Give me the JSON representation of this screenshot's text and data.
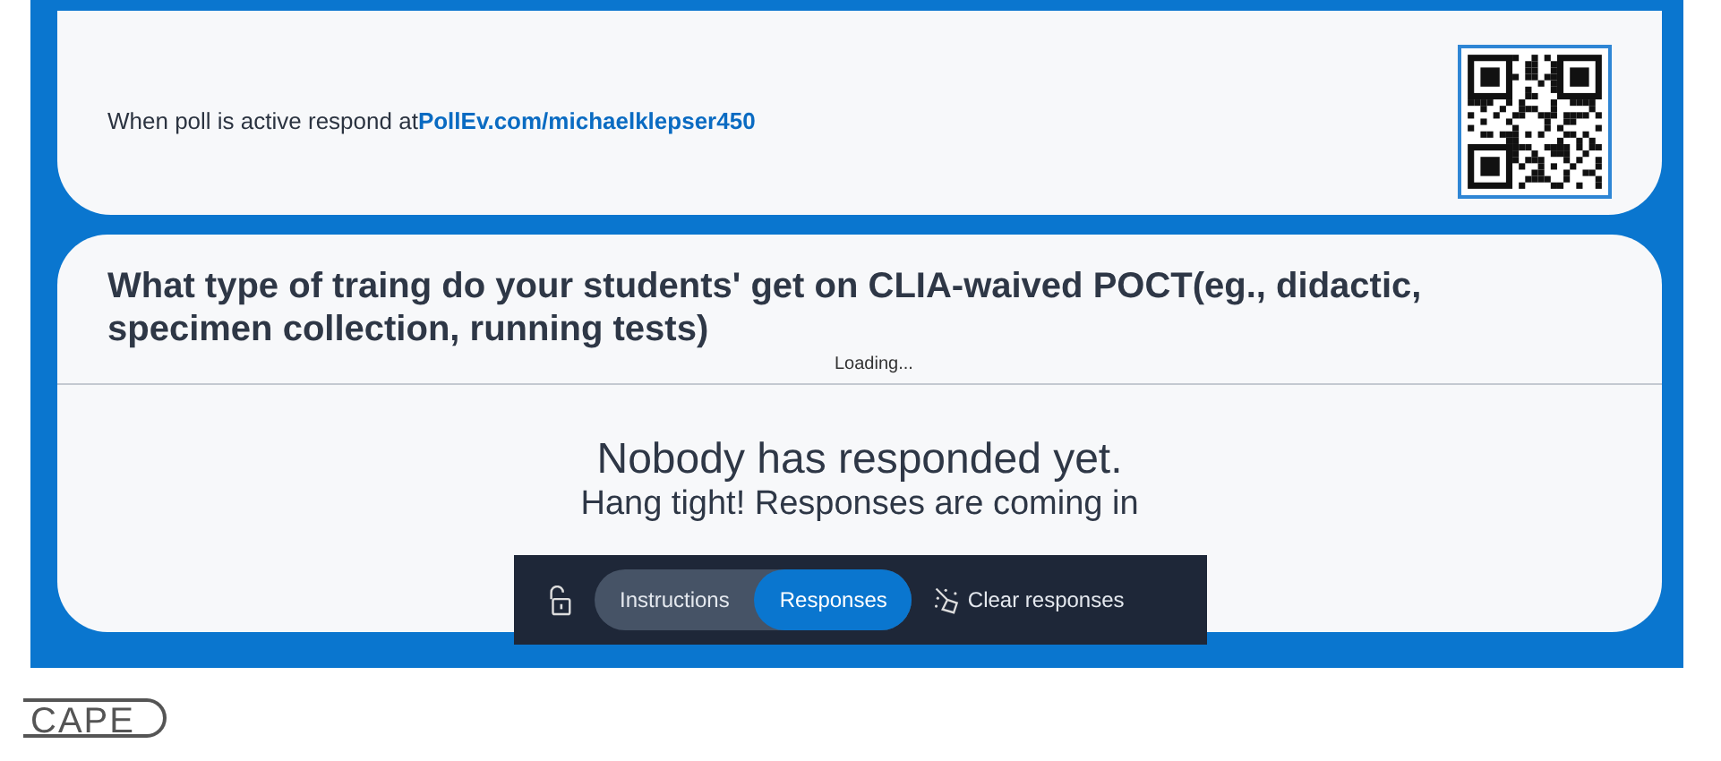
{
  "join_card": {
    "prompt": "When poll is active respond at",
    "link": "PollEv.com/michaelklepser450"
  },
  "question_card": {
    "question": "What type of traing do your students' get on CLIA-waived POCT(eg., didactic, specimen collection, running tests)",
    "status": "Loading...",
    "empty_title": "Nobody has responded yet.",
    "empty_subtitle": "Hang tight! Responses are coming in"
  },
  "toolbar": {
    "tabs": [
      {
        "label": "Instructions",
        "selected": false
      },
      {
        "label": "Responses",
        "selected": true
      }
    ],
    "clear_button": "Clear responses"
  },
  "logo": "CAPE"
}
